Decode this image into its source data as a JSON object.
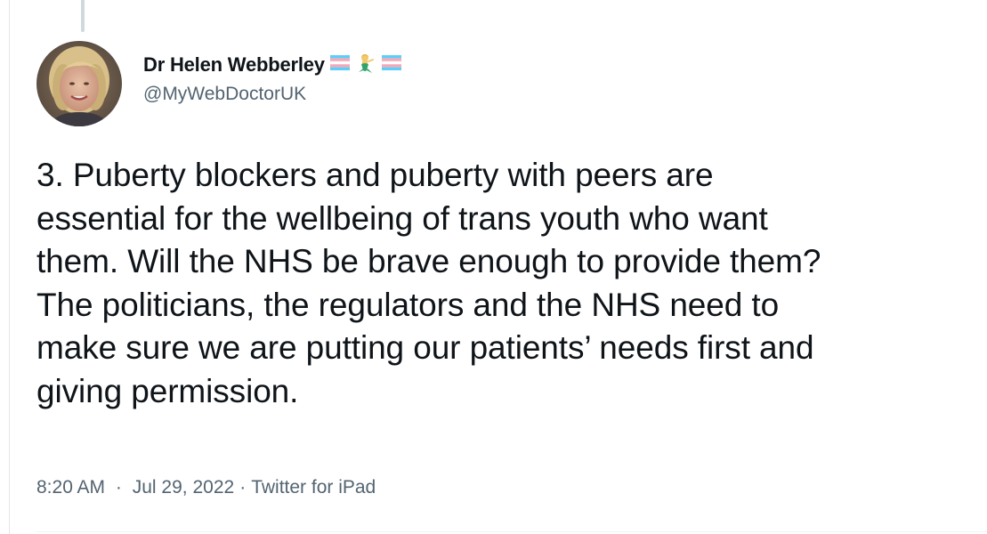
{
  "tweet": {
    "author": {
      "display_name": "Dr Helen Webberley",
      "handle": "@MyWebDoctorUK",
      "name_emojis": [
        "transgender-flag-icon",
        "merperson-icon",
        "transgender-flag-icon"
      ]
    },
    "text": "3. Puberty blockers and puberty with peers are\nessential for the wellbeing of trans youth who want\nthem. Will the NHS be brave enough to provide them?\nThe politicians, the regulators and the NHS need to\nmake sure we are putting our patients’ needs first and\ngiving permission.",
    "time": "8:20 AM",
    "date": "Jul 29, 2022",
    "separator": "·",
    "source": "Twitter for iPad"
  },
  "colors": {
    "text_primary": "#0f1419",
    "text_secondary": "#536471",
    "trans_blue": "#5bcefa",
    "trans_pink": "#f5a9b8",
    "trans_white": "#ffffff"
  }
}
